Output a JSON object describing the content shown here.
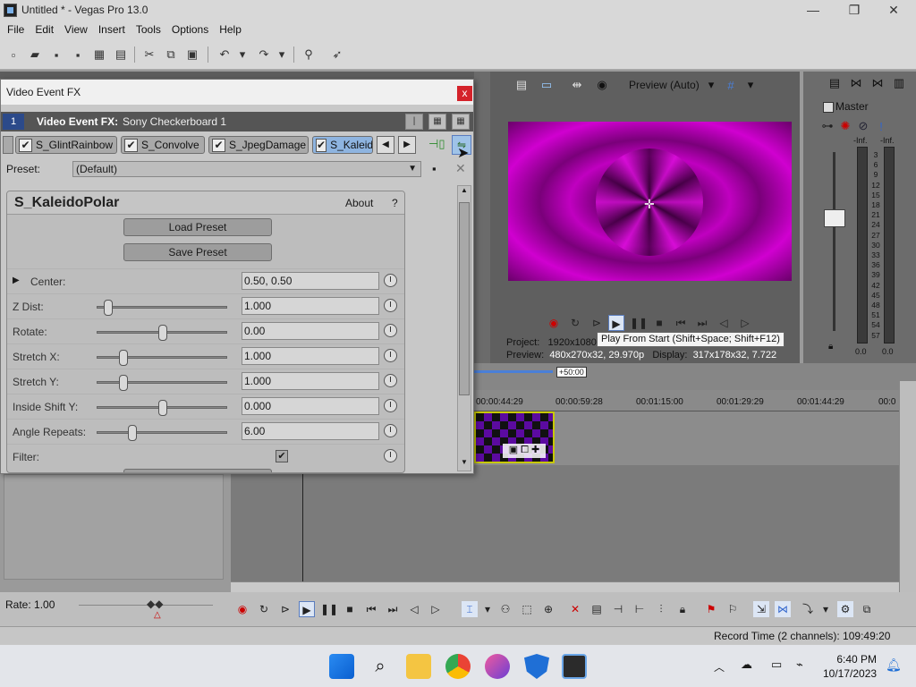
{
  "window": {
    "title": "Untitled * - Vegas Pro 13.0"
  },
  "menu": [
    "File",
    "Edit",
    "View",
    "Insert",
    "Tools",
    "Options",
    "Help"
  ],
  "fx_window": {
    "title": "Video Event FX",
    "close": "x",
    "header_index": "1",
    "header_label": "Video Event FX:",
    "header_name": "Sony Checkerboard 1",
    "chain": [
      {
        "label": "S_GlintRainbow",
        "checked": true
      },
      {
        "label": "S_Convolve",
        "checked": true
      },
      {
        "label": "S_JpegDamage",
        "checked": true
      },
      {
        "label": "S_Kaleid",
        "checked": true,
        "active": true
      }
    ],
    "preset_label": "Preset:",
    "preset_value": "(Default)",
    "plugin_name": "S_KaleidoPolar",
    "about": "About",
    "help": "?",
    "load_preset": "Load Preset",
    "save_preset": "Save Preset",
    "params": [
      {
        "label": "Center:",
        "value": "0.50, 0.50",
        "slider": null,
        "expandable": true
      },
      {
        "label": "Z Dist:",
        "value": "1.000",
        "slider": 0.05
      },
      {
        "label": "Rotate:",
        "value": "0.00",
        "slider": 0.5
      },
      {
        "label": "Stretch X:",
        "value": "1.000",
        "slider": 0.18
      },
      {
        "label": "Stretch Y:",
        "value": "1.000",
        "slider": 0.18
      },
      {
        "label": "Inside Shift Y:",
        "value": "0.000",
        "slider": 0.5
      },
      {
        "label": "Angle Repeats:",
        "value": "6.00",
        "slider": 0.25
      },
      {
        "label": "Filter:",
        "value": "",
        "checkbox": true
      }
    ]
  },
  "preview": {
    "mode": "Preview (Auto)",
    "project_label": "Project:",
    "project_value": "1920x1080",
    "preview_label": "Preview:",
    "preview_value": "480x270x32, 29.970p",
    "display_label": "Display:",
    "display_value": "317x178x32, 7.722",
    "tooltip": "Play From Start (Shift+Space; Shift+F12)"
  },
  "mixer": {
    "title": "Master",
    "inf_left": "-Inf.",
    "inf_right": "-Inf.",
    "scale": [
      "3",
      "6",
      "9",
      "12",
      "15",
      "18",
      "21",
      "24",
      "27",
      "30",
      "33",
      "36",
      "39",
      "42",
      "45",
      "48",
      "51",
      "54",
      "57"
    ],
    "val_left": "0.0",
    "val_right": "0.0"
  },
  "timeline": {
    "offset": "+50:00",
    "ticks": [
      "00:00:44:29",
      "00:00:59:28",
      "00:01:15:00",
      "00:01:29:29",
      "00:01:44:29",
      "00:0"
    ]
  },
  "rate": "Rate: 1.00",
  "status": "Record Time (2 channels): 109:49:20",
  "clock": {
    "time": "6:40 PM",
    "date": "10/17/2023"
  },
  "colors": {
    "accent": "#8eb4e0",
    "preview_magenta": "#c000c0",
    "clip_purple": "#5b0aa0"
  }
}
